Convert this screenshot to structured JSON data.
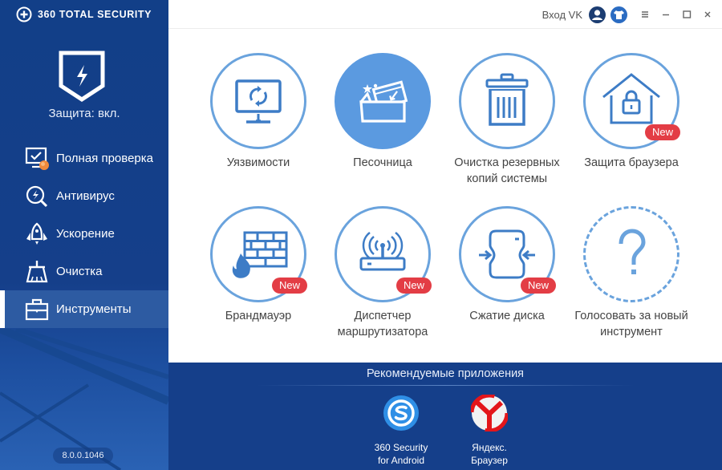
{
  "app": {
    "brand_name": "360 TOTAL SECURITY",
    "protection_status": "Защита: вкл.",
    "version": "8.0.0.1046"
  },
  "titlebar": {
    "vk_login": "Вход VK",
    "icons": [
      "user-icon",
      "shirt-icon",
      "menu-icon",
      "minimize-icon",
      "maximize-icon",
      "close-icon"
    ]
  },
  "sidebar": {
    "items": [
      {
        "label": "Полная проверка",
        "icon": "monitor-check-icon",
        "active": false
      },
      {
        "label": "Антивирус",
        "icon": "antivirus-search-icon",
        "active": false
      },
      {
        "label": "Ускорение",
        "icon": "rocket-icon",
        "active": false
      },
      {
        "label": "Очистка",
        "icon": "broom-icon",
        "active": false
      },
      {
        "label": "Инструменты",
        "icon": "toolbox-icon",
        "active": true
      }
    ]
  },
  "tools": {
    "badge_label": "New",
    "items": [
      {
        "label": "Уязвимости",
        "icon": "monitor-refresh-icon",
        "badge": false
      },
      {
        "label": "Песочница",
        "icon": "sandbox-box-icon",
        "badge": false,
        "highlighted": true
      },
      {
        "label": "Очистка резервных копий системы",
        "icon": "trash-bin-icon",
        "badge": false
      },
      {
        "label": "Защита браузера",
        "icon": "house-lock-icon",
        "badge": true
      },
      {
        "label": "Брандмауэр",
        "icon": "firewall-icon",
        "badge": true
      },
      {
        "label": "Диспетчер маршрутизатора",
        "icon": "router-icon",
        "badge": true
      },
      {
        "label": "Сжатие диска",
        "icon": "disk-compress-icon",
        "badge": true
      },
      {
        "label": "Голосовать за новый инструмент",
        "icon": "question-mark-icon",
        "badge": false
      }
    ]
  },
  "recommended": {
    "title": "Рекомендуемые приложения",
    "apps": [
      {
        "name_line1": "360 Security",
        "name_line2": "for Android",
        "icon": "360-security-android-icon"
      },
      {
        "name_line1": "Яндекс.",
        "name_line2": "Браузер",
        "icon": "yandex-browser-icon"
      }
    ]
  },
  "colors": {
    "sidebar_bg": "#123f88",
    "accent_blue": "#5b9ae0",
    "ring_blue": "#6aa3dd",
    "badge_red": "#e33d45",
    "active_item_bg": "#2d5ba2"
  }
}
